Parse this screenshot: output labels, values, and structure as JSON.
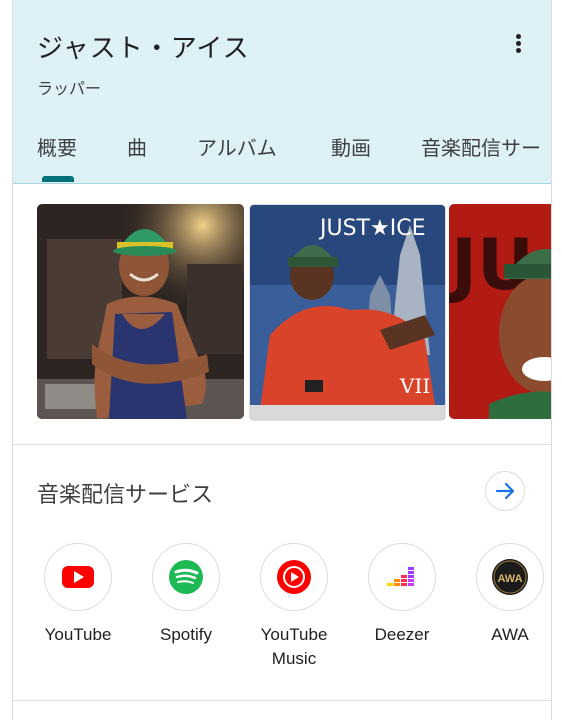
{
  "entity": {
    "title": "ジャスト・アイス",
    "subtitle": "ラッパー",
    "more_icon": "more-vert-icon"
  },
  "tabs": [
    {
      "label": "概要",
      "selected": true
    },
    {
      "label": "曲",
      "selected": false
    },
    {
      "label": "アルバム",
      "selected": false
    },
    {
      "label": "動画",
      "selected": false
    },
    {
      "label": "音楽配信サー",
      "selected": false
    }
  ],
  "images": {
    "album_text": "JUST★ICE",
    "album_subtext": "VII",
    "third_text": "JU"
  },
  "services_section": {
    "title": "音楽配信サービス",
    "arrow_icon": "arrow-right-icon",
    "items": [
      {
        "name": "YouTube",
        "icon": "youtube-icon",
        "color": "#ff0000"
      },
      {
        "name": "Spotify",
        "icon": "spotify-icon",
        "color": "#1db954"
      },
      {
        "name": "YouTube Music",
        "icon": "youtube-music-icon",
        "color": "#ff0000"
      },
      {
        "name": "Deezer",
        "icon": "deezer-icon",
        "color": "#a238ff"
      },
      {
        "name": "AWA",
        "icon": "awa-icon",
        "color": "#9e7b3c"
      }
    ]
  },
  "colors": {
    "header_bg": "#def1f6",
    "tab_indicator": "#00707a",
    "arrow": "#1a73e8"
  }
}
